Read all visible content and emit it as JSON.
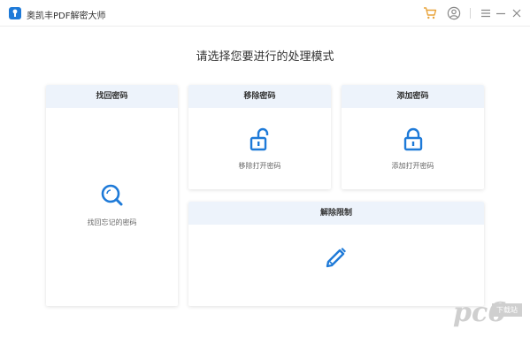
{
  "titlebar": {
    "title": "奥凯丰PDF解密大师",
    "icons": {
      "logo": "keyhole-logo-icon",
      "cart": "shopping-cart-icon",
      "user": "user-account-icon",
      "menu": "hamburger-menu-icon",
      "minimize": "minimize-icon",
      "close": "close-icon"
    }
  },
  "main": {
    "heading": "请选择您要进行的处理模式",
    "cards": {
      "find_password": {
        "title": "找回密码",
        "label": "找回忘记的密码",
        "icon": "search-magnifier-icon"
      },
      "remove_password": {
        "title": "移除密码",
        "label": "移除打开密码",
        "icon": "unlocked-padlock-icon"
      },
      "add_password": {
        "title": "添加密码",
        "label": "添加打开密码",
        "icon": "locked-padlock-icon"
      },
      "remove_restrictions": {
        "title": "解除限制",
        "icon": "pencil-edit-icon"
      }
    }
  },
  "watermark": {
    "main": "pc6",
    "box": "下载站"
  },
  "colors": {
    "accent": "#1e7ad8",
    "card_header_bg": "#edf3fb",
    "text_primary": "#333333",
    "text_secondary": "#666666"
  }
}
